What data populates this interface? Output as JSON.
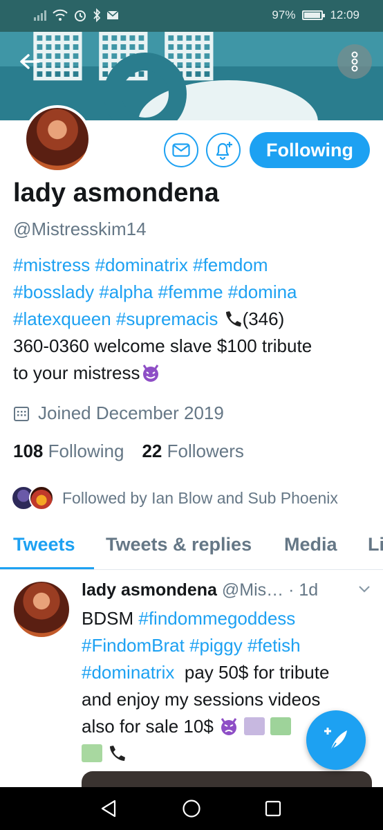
{
  "status_bar": {
    "battery_text": "97%",
    "battery_level": 0.97,
    "time": "12:09"
  },
  "profile": {
    "name": "lady asmondena",
    "handle": "@Mistresskim14",
    "follow_button": "Following",
    "bio": {
      "tags_line1": [
        "#mistress",
        "#dominatrix",
        "#femdom"
      ],
      "tags_line2": [
        "#bosslady",
        "#alpha",
        "#femme",
        "#domina"
      ],
      "tags_line3": [
        "#latexqueen",
        "#supremacis"
      ],
      "phone_start": "(346)",
      "text_line4": "360-0360 welcome slave $100 tribute",
      "text_line5": "to your mistress"
    },
    "joined": "Joined December 2019",
    "following_count": "108",
    "following_label": "Following",
    "followers_count": "22",
    "followers_label": "Followers",
    "followed_by": "Followed by Ian Blow and Sub Phoenix"
  },
  "tabs": [
    "Tweets",
    "Tweets & replies",
    "Media",
    "Likes"
  ],
  "tweet": {
    "name": "lady asmondena",
    "handle": "@Mis…",
    "time": "· 1d",
    "text_line1_word": "BDSM",
    "text_line1_tag": "#findommegoddess",
    "text_line2_tags": [
      "#FindomBrat",
      "#piggy",
      "#fetish"
    ],
    "text_line3_tag": "#dominatrix",
    "text_line3_rest": "pay 50$ for tribute",
    "text_line4": "and enjoy my sessions videos",
    "text_line5": "also for sale 10$"
  },
  "colors": {
    "accent": "#1da1f2",
    "status_bar": "#2b6466",
    "secondary_text": "#657786"
  }
}
